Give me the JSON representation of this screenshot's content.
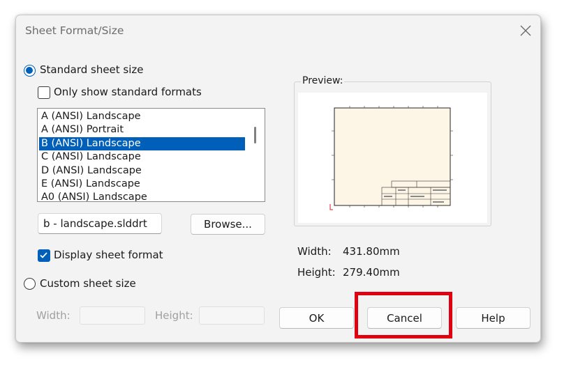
{
  "window": {
    "title": "Sheet Format/Size",
    "close_icon": "close-icon"
  },
  "standard": {
    "radio_label": "Standard sheet size",
    "checked": true,
    "only_standard_label": "Only show standard formats",
    "only_standard_checked": false,
    "list_items": [
      "A (ANSI) Landscape",
      "A (ANSI) Portrait",
      "B (ANSI) Landscape",
      "C (ANSI) Landscape",
      "D (ANSI) Landscape",
      "E (ANSI) Landscape",
      "A0 (ANSI) Landscape"
    ],
    "selected_item": "B (ANSI) Landscape",
    "file_value": "b - landscape.slddrt",
    "browse_label": "Browse...",
    "display_format_label": "Display sheet format",
    "display_format_checked": true
  },
  "custom": {
    "radio_label": "Custom sheet size",
    "checked": false,
    "width_label": "Width:",
    "height_label": "Height:",
    "width_value": "",
    "height_value": ""
  },
  "preview": {
    "label": "Preview:",
    "sheet_color": "#fdf6e6"
  },
  "dimensions": {
    "width_label": "Width:",
    "width_value": "431.80mm",
    "height_label": "Height:",
    "height_value": "279.40mm"
  },
  "buttons": {
    "ok": "OK",
    "cancel": "Cancel",
    "help": "Help"
  },
  "colors": {
    "accent": "#005fb8",
    "highlight": "#e00010"
  }
}
